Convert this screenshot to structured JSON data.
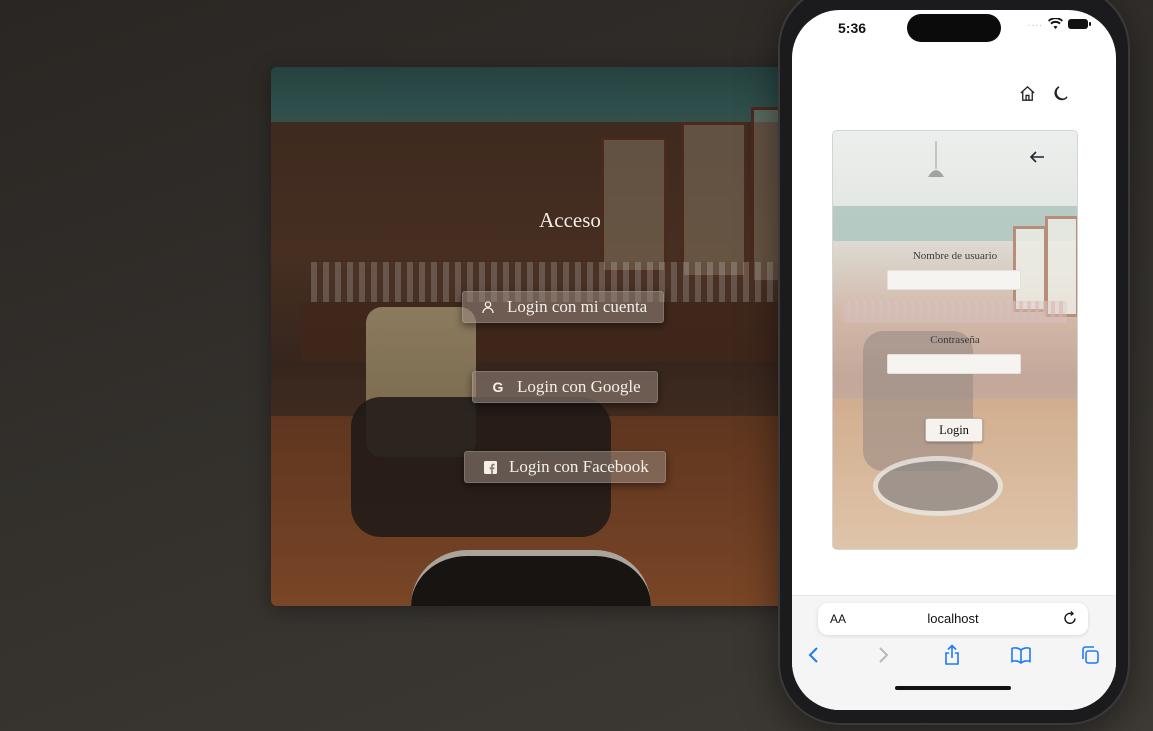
{
  "desktop": {
    "title": "Acceso",
    "buttons": [
      {
        "label": "Login con mi cuenta",
        "icon": "user-icon"
      },
      {
        "label": "Login con Google",
        "icon": "google-icon"
      },
      {
        "label": "Login con Facebook",
        "icon": "facebook-icon"
      }
    ]
  },
  "mobile": {
    "status": {
      "time": "5:36",
      "signal": "...."
    },
    "top_icons": [
      "home-icon",
      "moon-icon"
    ],
    "form": {
      "username_label": "Nombre de usuario",
      "username_value": "",
      "password_label": "Contraseña",
      "password_value": "",
      "login_button": "Login"
    },
    "browser": {
      "aa_label": "AA",
      "url": "localhost",
      "toolbar": [
        "back-icon",
        "forward-icon",
        "share-icon",
        "bookmarks-icon",
        "tabs-icon"
      ]
    }
  },
  "colors": {
    "accent_blue": "#1c7cf4",
    "button_overlay": "#968780"
  }
}
